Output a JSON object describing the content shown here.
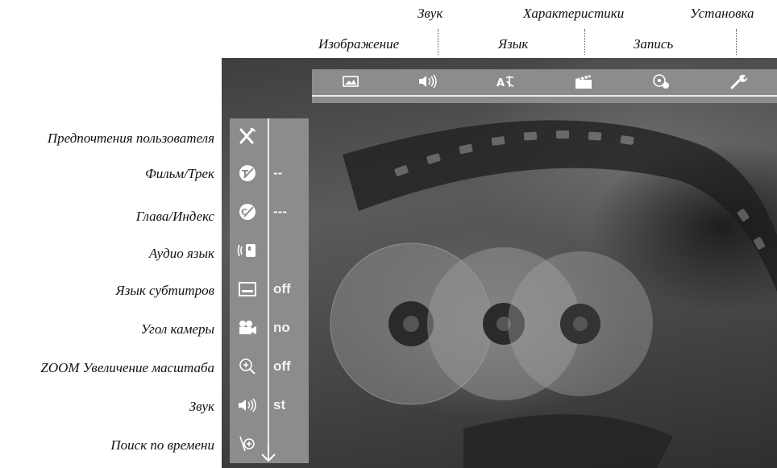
{
  "top_labels": {
    "sound": "Звук",
    "features": "Характеристики",
    "setup": "Установка",
    "picture": "Изображение",
    "language": "Язык",
    "recording": "Запись"
  },
  "left_labels": [
    "Предпочтения пользователя",
    "Фильм/Трек",
    "Глава/Индекс",
    "Аудио язык",
    "Язык субтитров",
    "Угол камеры",
    "ZOOM Увеличение масштаба",
    "Звук",
    "Поиск по времени"
  ],
  "menu_rows": [
    {
      "icon": "user-preferences-icon",
      "value": ""
    },
    {
      "icon": "title-track-icon",
      "value": "--"
    },
    {
      "icon": "chapter-index-icon",
      "value": "---"
    },
    {
      "icon": "audio-language-icon",
      "value": ""
    },
    {
      "icon": "subtitle-icon",
      "value": "off"
    },
    {
      "icon": "camera-angle-icon",
      "value": "no"
    },
    {
      "icon": "zoom-icon",
      "value": "off"
    },
    {
      "icon": "sound-icon",
      "value": "st"
    },
    {
      "icon": "time-search-icon",
      "value": ""
    }
  ],
  "top_tabs": [
    "picture-icon",
    "sound-icon",
    "language-icon",
    "features-icon",
    "recording-icon",
    "setup-icon"
  ],
  "colors": {
    "panel": "#8c8c8c",
    "accent_line": "#ececec",
    "value_text": "#f2f2f2"
  }
}
